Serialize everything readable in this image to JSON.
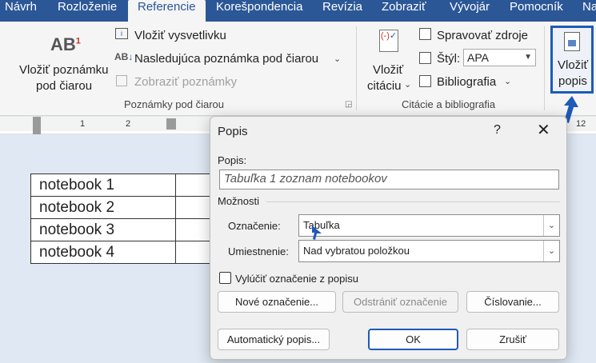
{
  "ribbon_tabs": [
    "Návrh",
    "Rozloženie",
    "Referencie",
    "Korešpondencia",
    "Revízia",
    "Zobraziť",
    "Vývojár",
    "Pomocník",
    "Na"
  ],
  "footnotes": {
    "insert_footnote_line1": "Vložiť poznámku",
    "insert_footnote_line2": "pod čiarou",
    "insert_endnote": "Vložiť vysvetlivku",
    "next_footnote": "Nasledujúca poznámka pod čiarou",
    "show_notes": "Zobraziť poznámky",
    "group_label": "Poznámky pod čiarou"
  },
  "citations": {
    "insert_citation_line1": "Vložiť",
    "insert_citation_line2": "citáciu",
    "manage_sources": "Spravovať zdroje",
    "style_label": "Štýl:",
    "style_value": "APA",
    "bibliography": "Bibliografia",
    "group_label": "Citácie a bibliografia"
  },
  "captions": {
    "insert_caption_line1": "Vložiť",
    "insert_caption_line2": "popis"
  },
  "ruler": [
    "1",
    "2",
    "12"
  ],
  "document_table": [
    "notebook 1",
    "notebook 2",
    "notebook 3",
    "notebook 4"
  ],
  "dialog": {
    "title": "Popis",
    "help": "?",
    "caption_label": "Popis:",
    "caption_value": "Tabuľka 1 zoznam notebookov",
    "options_label": "Možnosti",
    "label_label": "Označenie:",
    "label_value": "Tabuľka",
    "position_label": "Umiestnenie:",
    "position_value": "Nad vybratou položkou",
    "exclude_label": "Vylúčiť označenie z popisu",
    "new_label_button": "Nové označenie...",
    "delete_label_button": "Odstrániť označenie",
    "numbering_button": "Číslovanie...",
    "autocaption_button": "Automatický popis...",
    "ok_button": "OK",
    "cancel_button": "Zrušiť"
  },
  "colors": {
    "ribbon_blue": "#2b5797",
    "highlight_blue": "#1e5bb8"
  }
}
